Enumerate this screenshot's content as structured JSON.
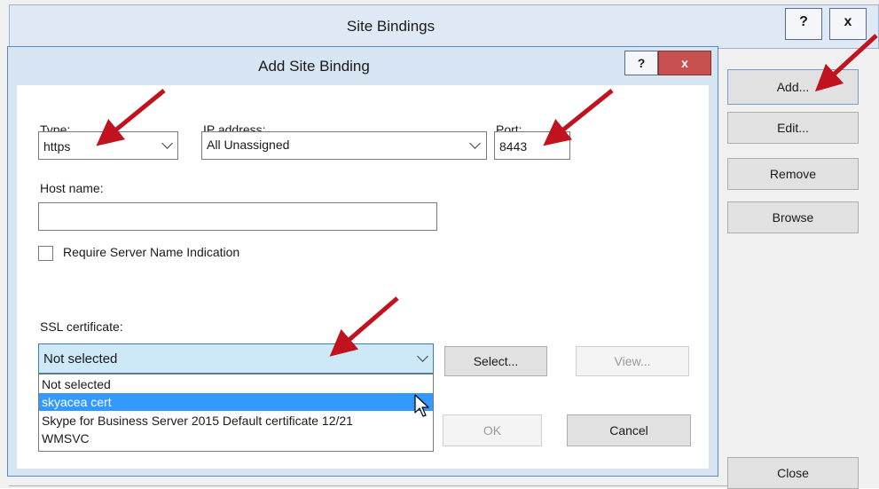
{
  "site_bindings": {
    "title": "Site Bindings",
    "help_glyph": "?",
    "close_glyph": "x",
    "buttons": {
      "add": "Add...",
      "edit": "Edit...",
      "remove": "Remove",
      "browse": "Browse",
      "close": "Close"
    }
  },
  "dialog": {
    "title": "Add Site Binding",
    "help_glyph": "?",
    "close_glyph": "x",
    "type": {
      "label": "Type:",
      "value": "https"
    },
    "ip_address": {
      "label": "IP address:",
      "value": "All Unassigned"
    },
    "port": {
      "label": "Port:",
      "value": "8443"
    },
    "host_name": {
      "label": "Host name:",
      "value": ""
    },
    "sni": {
      "label": "Require Server Name Indication",
      "checked": false
    },
    "ssl": {
      "label": "SSL certificate:",
      "value": "Not selected",
      "options": [
        "Not selected",
        "skyacea cert",
        "Skype for Business Server 2015 Default certificate 12/21",
        "WMSVC"
      ],
      "highlighted_index": 1
    },
    "buttons": {
      "select": "Select...",
      "view": "View...",
      "ok": "OK",
      "cancel": "Cancel"
    }
  },
  "colors": {
    "accent": "#3399ff",
    "dropdown_highlight": "#3399ff",
    "dropdown_selected_bg": "#cde8f7",
    "arrow": "#c1121f",
    "close_button": "#c75050"
  }
}
